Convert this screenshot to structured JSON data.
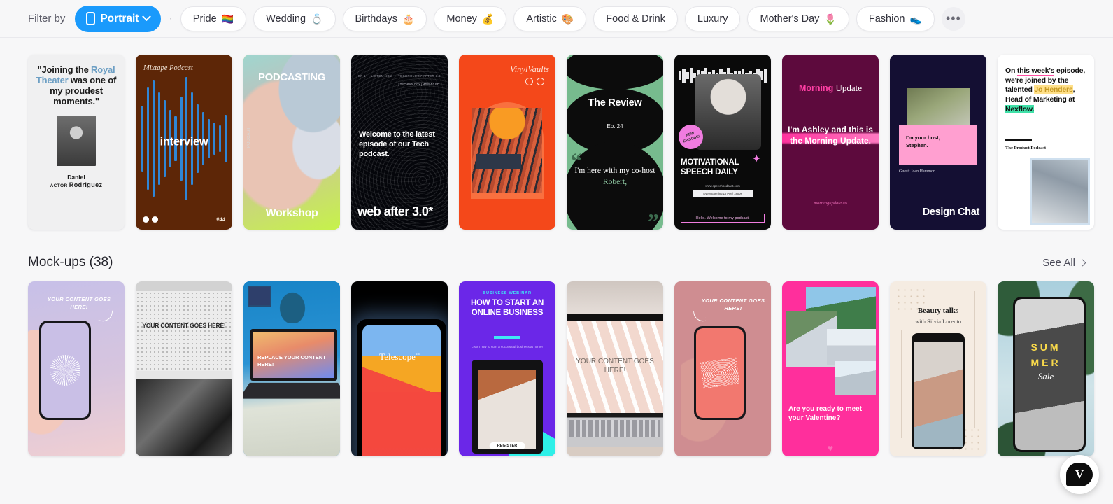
{
  "filter": {
    "label": "Filter by",
    "active_chip": {
      "text": "Portrait",
      "icon": "phone-portrait-icon",
      "chevron": "chevron-down-icon",
      "color": "#1a9afc"
    },
    "chips": [
      {
        "label": "Pride",
        "emoji": "🏳️‍🌈"
      },
      {
        "label": "Wedding",
        "emoji": "💍"
      },
      {
        "label": "Birthdays",
        "emoji": "🎂"
      },
      {
        "label": "Money",
        "emoji": "💰"
      },
      {
        "label": "Artistic",
        "emoji": "🎨"
      },
      {
        "label": "Food & Drink",
        "emoji": ""
      },
      {
        "label": "Luxury",
        "emoji": ""
      },
      {
        "label": "Mother's Day",
        "emoji": "🌷"
      },
      {
        "label": "Fashion",
        "emoji": "👟"
      }
    ],
    "more_label": "•••"
  },
  "row1": {
    "cards": [
      {
        "name": "quote-testimonial",
        "quote_a": "\"Joining the ",
        "quote_hl": "Royal Theater",
        "quote_b": " was one of my proudest moments.\"",
        "person": "Daniel",
        "person_last": "Rodriguez",
        "role": "ACTOR"
      },
      {
        "name": "mixtape-podcast",
        "title": "Mixtape Podcast",
        "word": "interview",
        "episode": "#44"
      },
      {
        "name": "podcasting-workshop",
        "top": "PODCASTING",
        "bottom": "Workshop",
        "vertical": "PODCAST"
      },
      {
        "name": "tech-podcast",
        "meta_left": "EP 1",
        "meta_mid": "LISTEN NOW",
        "meta_right": "TECHNOLOGY AFTER 3.0",
        "sub": "[ TECHNOLOGY ]\nWEB 4.0 ED",
        "headline": "Welcome to the latest episode of our Tech podcast.",
        "big": "web after 3.0*"
      },
      {
        "name": "vinyl-vaults",
        "brand": "VinylVaults"
      },
      {
        "name": "the-review",
        "title": "The Review",
        "episode": "Ep. 24",
        "quote_a": "I'm here with my co-host ",
        "quote_hl": "Robert,"
      },
      {
        "name": "motivational-speech",
        "badge": "NEW EPISODE!",
        "title": "MOTIVATIONAL SPEECH DAILY",
        "url": "www.speechpodcast.com",
        "chip": "Every Evening 10 PM / 1800s",
        "footer": "Hello. Welcome to my podcast."
      },
      {
        "name": "morning-update",
        "title_a": "Morning",
        "title_b": " Update",
        "message": "I'm Ashley and this is the Morning Update.",
        "url": "morningupdate.co"
      },
      {
        "name": "design-chat",
        "host": "I'm your host,\nStephen.",
        "guest": "Guest: Joan Hammon",
        "title": "Design Chat"
      },
      {
        "name": "product-podcast",
        "line_a": "On ",
        "line_underline": "this week's",
        "line_b": " episode, we're joined by the talented ",
        "name_hl": "Jo Henders",
        "line_c": ", Head of Marketing at ",
        "brand_hl": "Nexflow.",
        "sub": "The Product Podcast"
      }
    ]
  },
  "mockups_section": {
    "title": "Mock-ups (38)",
    "see_all": "See All"
  },
  "row2": {
    "cards": [
      {
        "name": "hand-phone-purple",
        "caption": "YOUR CONTENT GOES HERE!"
      },
      {
        "name": "grey-monitor",
        "caption": "YOUR CONTENT GOES HERE!"
      },
      {
        "name": "laptop-desk",
        "caption": "REPLACE YOUR CONTENT HERE!"
      },
      {
        "name": "telescope-phone",
        "title": "Telescope",
        "tm": "™"
      },
      {
        "name": "business-webinar",
        "kicker": "BUSINESS WEBINAR",
        "headline": "HOW TO START AN ONLINE BUSINESS",
        "sub": "Learn how to start a successful business at home!",
        "button": "REGISTER"
      },
      {
        "name": "macbook-pink",
        "caption": "YOUR CONTENT GOES HERE!"
      },
      {
        "name": "hand-phone-pink",
        "caption": "YOUR CONTENT GOES HERE!"
      },
      {
        "name": "valentine-collage",
        "headline": "Are you ready to meet your Valentine?",
        "heart": "♥"
      },
      {
        "name": "beauty-talks",
        "title": "Beauty talks",
        "sub": "with Silvia Lorento"
      },
      {
        "name": "summer-phone",
        "l1": "SUM",
        "l2": "MER",
        "l3": "Sale"
      }
    ]
  },
  "fab": {
    "label": "V",
    "name": "chat-bubble-fab"
  }
}
